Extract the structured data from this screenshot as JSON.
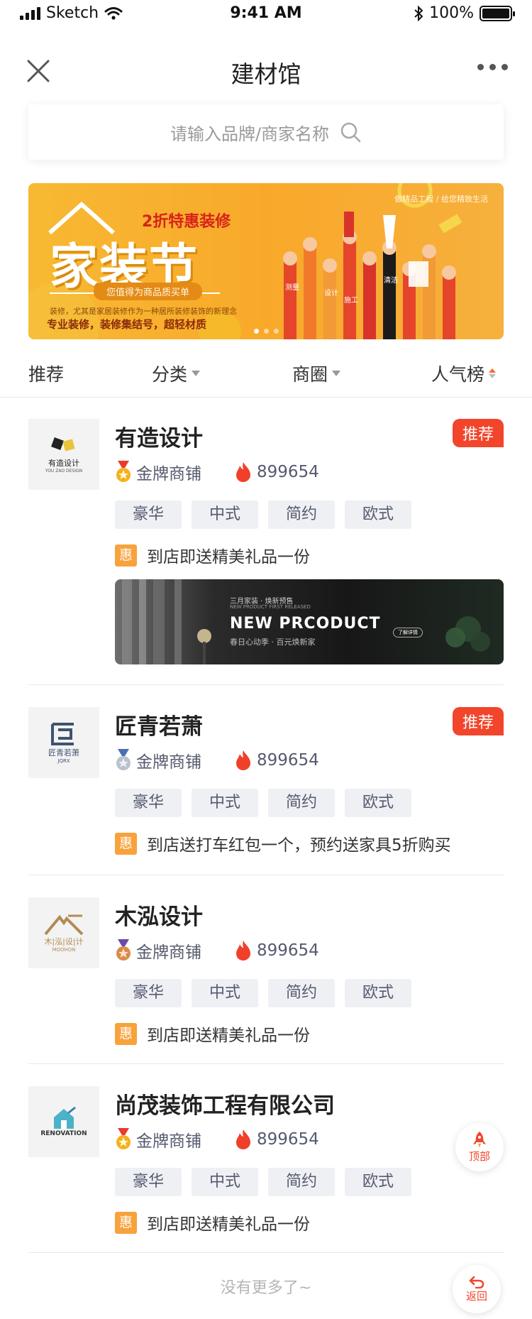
{
  "status_bar": {
    "carrier": "Sketch",
    "time": "9:41 AM",
    "battery": "100%"
  },
  "nav": {
    "title": "建材馆"
  },
  "search": {
    "placeholder": "请输入品牌/商家名称"
  },
  "banner": {
    "tag": "做精品工程 / 给您精致生活",
    "promo": "2折特惠装修",
    "headline": "家装节",
    "pill": "您值得为商品质买单",
    "line1": "装修，尤其是家居装修作为一种居所装修装饰的新理念",
    "line2": "专业装修，装修集结号，超轻材质",
    "hand_labels": [
      "测量",
      "设计",
      "施工",
      "清洁"
    ],
    "slide_index": 1,
    "slide_count": 3
  },
  "filters": {
    "recommend": "推荐",
    "category": "分类",
    "district": "商圈",
    "popularity": "人气榜"
  },
  "shops": [
    {
      "name": "有造设计",
      "badge": "推荐",
      "logo_text": "有造设计",
      "logo_sub": "YOU ZAO DESIGN",
      "level": "金牌商铺",
      "hot": "899654",
      "tags": [
        "豪华",
        "中式",
        "简约",
        "欧式"
      ],
      "offer": "到店即送精美礼品一份",
      "ad": {
        "cap1": "三月家装 · 焕新预售",
        "cap2": "NEW PRODUCT FIRST RELEASED",
        "headline": "NEW PRCODUCT",
        "cap3": "春日心动季 · 百元焕新家",
        "button": "了解详情"
      }
    },
    {
      "name": "匠青若萧",
      "badge": "推荐",
      "logo_text": "匠青若萧",
      "logo_sub": "JQRX",
      "level": "金牌商铺",
      "hot": "899654",
      "tags": [
        "豪华",
        "中式",
        "简约",
        "欧式"
      ],
      "offer": "到店送打车红包一个，预约送家具5折购买"
    },
    {
      "name": "木泓设计",
      "logo_text": "木|泓|设|计",
      "logo_sub": "MOOHON",
      "level": "金牌商铺",
      "hot": "899654",
      "tags": [
        "豪华",
        "中式",
        "简约",
        "欧式"
      ],
      "offer": "到店即送精美礼品一份"
    },
    {
      "name": "尚茂装饰工程有限公司",
      "logo_text": "RENOVATION",
      "level": "金牌商铺",
      "hot": "899654",
      "tags": [
        "豪华",
        "中式",
        "简约",
        "欧式"
      ],
      "offer": "到店即送精美礼品一份"
    }
  ],
  "offer_icon": "惠",
  "footer": {
    "no_more": "没有更多了~"
  },
  "fab": {
    "top": "顶部",
    "back": "返回"
  },
  "colors": {
    "accent": "#f2452b",
    "tag_bg": "#eef0f4",
    "offer_icon": "#f7a23b",
    "banner": "#f8b030"
  },
  "icons": [
    "signal-icon",
    "wifi-icon",
    "bluetooth-icon",
    "battery-icon",
    "close-icon",
    "more-icon",
    "search-icon",
    "medal-icon",
    "flame-icon",
    "rocket-icon",
    "back-arrow-icon"
  ]
}
